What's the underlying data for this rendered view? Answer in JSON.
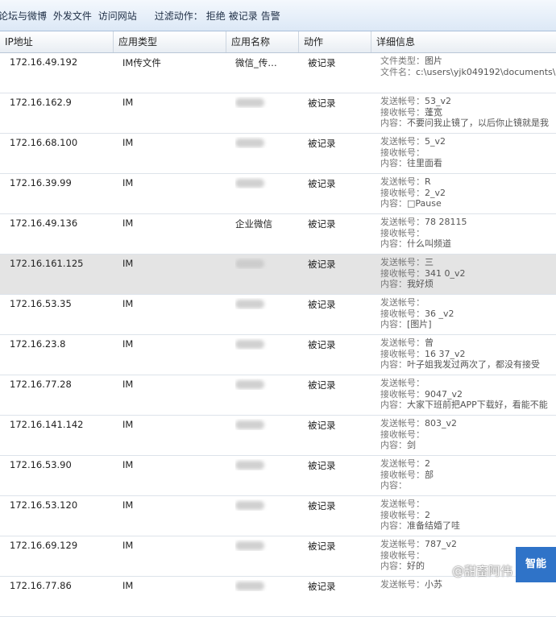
{
  "filterbar": {
    "nav": [
      "论坛与微博",
      "外发文件",
      "访问网站"
    ],
    "action_label": "过滤动作：",
    "actions": [
      "拒绝",
      "被记录",
      "告警"
    ]
  },
  "table": {
    "headers": [
      "IP地址",
      "应用类型",
      "应用名称",
      "动作",
      "详细信息"
    ],
    "rows": [
      {
        "ip": "172.16.49.192",
        "type": "IM传文件",
        "app": "微信_传…",
        "action": "被记录",
        "detail": [
          [
            "文件类型：",
            "图片"
          ],
          [
            "文件名：",
            "c:\\users\\yjk049192\\documents\\"
          ]
        ]
      },
      {
        "ip": "172.16.162.9",
        "type": "IM",
        "app": "",
        "action": "被记录",
        "detail": [
          [
            "发送帐号：",
            "53_v2"
          ],
          [
            "接收帐号：",
            "蓬宽"
          ],
          [
            "内容：",
            "不要问我止镜了，以后你止镜就是我"
          ]
        ]
      },
      {
        "ip": "172.16.68.100",
        "type": "IM",
        "app": "",
        "action": "被记录",
        "detail": [
          [
            "发送帐号：",
            "5_v2"
          ],
          [
            "接收帐号：",
            ""
          ],
          [
            "内容：",
            "往里面看"
          ]
        ]
      },
      {
        "ip": "172.16.39.99",
        "type": "IM",
        "app": "",
        "action": "被记录",
        "detail": [
          [
            "发送帐号：",
            "R"
          ],
          [
            "接收帐号：",
            "2_v2"
          ],
          [
            "内容：",
            "□Pause"
          ]
        ]
      },
      {
        "ip": "172.16.49.136",
        "type": "IM",
        "app": "企业微信",
        "action": "被记录",
        "detail": [
          [
            "发送帐号：",
            "78 28115"
          ],
          [
            "接收帐号：",
            ""
          ],
          [
            "内容：",
            "什么叫频道"
          ]
        ]
      },
      {
        "ip": "172.16.161.125",
        "type": "IM",
        "app": "",
        "action": "被记录",
        "detail": [
          [
            "发送帐号：",
            "三"
          ],
          [
            "接收帐号：",
            "341 0_v2"
          ],
          [
            "内容：",
            "我好烦"
          ]
        ]
      },
      {
        "ip": "172.16.53.35",
        "type": "IM",
        "app": "",
        "action": "被记录",
        "detail": [
          [
            "发送帐号：",
            ""
          ],
          [
            "接收帐号：",
            "36 _v2"
          ],
          [
            "内容：",
            "[图片]"
          ]
        ]
      },
      {
        "ip": "172.16.23.8",
        "type": "IM",
        "app": "",
        "action": "被记录",
        "detail": [
          [
            "发送帐号：",
            "曾"
          ],
          [
            "接收帐号：",
            "16 37_v2"
          ],
          [
            "内容：",
            "叶子姐我发过两次了，都没有接受"
          ]
        ]
      },
      {
        "ip": "172.16.77.28",
        "type": "IM",
        "app": "",
        "action": "被记录",
        "detail": [
          [
            "发送帐号：",
            ""
          ],
          [
            "接收帐号：",
            "9047_v2"
          ],
          [
            "内容：",
            "大家下班前把APP下载好，看能不能"
          ]
        ]
      },
      {
        "ip": "172.16.141.142",
        "type": "IM",
        "app": "",
        "action": "被记录",
        "detail": [
          [
            "发送帐号：",
            "803_v2"
          ],
          [
            "接收帐号：",
            ""
          ],
          [
            "内容：",
            "剑"
          ]
        ]
      },
      {
        "ip": "172.16.53.90",
        "type": "IM",
        "app": "",
        "action": "被记录",
        "detail": [
          [
            "发送帐号：",
            "2"
          ],
          [
            "接收帐号：",
            "部"
          ],
          [
            "内容：",
            ""
          ]
        ]
      },
      {
        "ip": "172.16.53.120",
        "type": "IM",
        "app": "",
        "action": "被记录",
        "detail": [
          [
            "发送帐号：",
            ""
          ],
          [
            "接收帐号：",
            "2"
          ],
          [
            "内容：",
            "准备结婚了哇"
          ]
        ]
      },
      {
        "ip": "172.16.69.129",
        "type": "IM",
        "app": "",
        "action": "被记录",
        "detail": [
          [
            "发送帐号：",
            "787_v2"
          ],
          [
            "接收帐号：",
            ""
          ],
          [
            "内容：",
            "好的"
          ]
        ]
      },
      {
        "ip": "172.16.77.86",
        "type": "IM",
        "app": "",
        "action": "被记录",
        "detail": [
          [
            "发送帐号：",
            "小苏"
          ]
        ]
      }
    ]
  },
  "badge": "智能",
  "watermark": "@甜畜阿伟"
}
